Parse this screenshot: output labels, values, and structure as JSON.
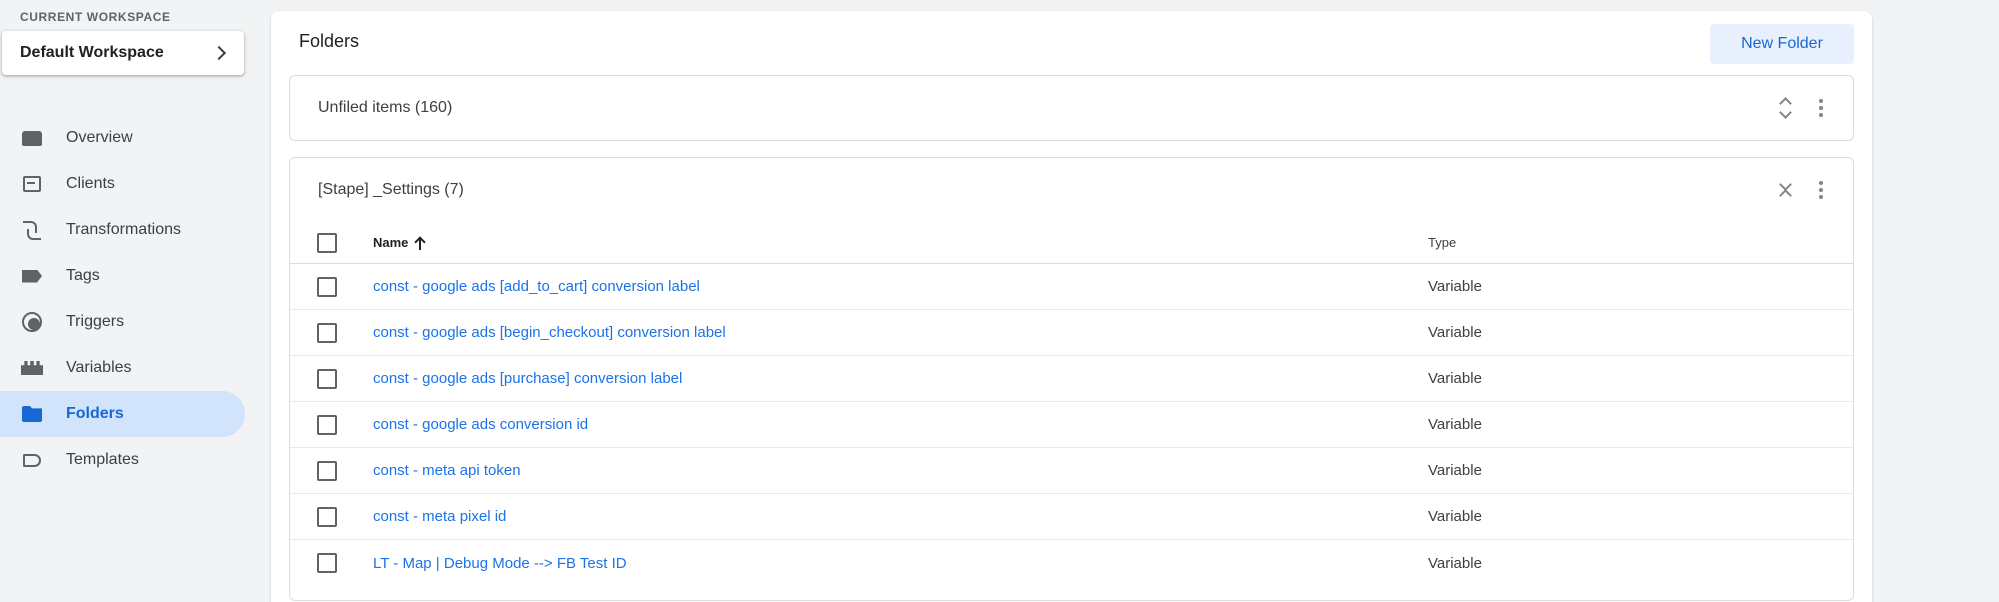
{
  "sidebar": {
    "workspace_caption": "CURRENT WORKSPACE",
    "workspace_name": "Default Workspace",
    "items": [
      {
        "label": "Overview",
        "icon": "overview-icon"
      },
      {
        "label": "Clients",
        "icon": "clients-icon"
      },
      {
        "label": "Transformations",
        "icon": "transformations-icon"
      },
      {
        "label": "Tags",
        "icon": "tag-icon"
      },
      {
        "label": "Triggers",
        "icon": "trigger-icon"
      },
      {
        "label": "Variables",
        "icon": "variables-icon"
      },
      {
        "label": "Folders",
        "icon": "folder-icon",
        "active": true
      },
      {
        "label": "Templates",
        "icon": "template-icon"
      }
    ]
  },
  "main": {
    "title": "Folders",
    "new_folder_label": "New Folder",
    "unfiled": {
      "title": "Unfiled items (160)"
    },
    "folder": {
      "title": "[Stape] _Settings (7)",
      "columns": {
        "name": "Name",
        "type": "Type"
      },
      "rows": [
        {
          "name": "const - google ads [add_to_cart] conversion label",
          "type": "Variable"
        },
        {
          "name": "const - google ads [begin_checkout] conversion label",
          "type": "Variable"
        },
        {
          "name": "const - google ads [purchase] conversion label",
          "type": "Variable"
        },
        {
          "name": "const - google ads conversion id",
          "type": "Variable"
        },
        {
          "name": "const - meta api token",
          "type": "Variable"
        },
        {
          "name": "const - meta pixel id",
          "type": "Variable"
        },
        {
          "name": "LT - Map | Debug Mode --> FB Test ID",
          "type": "Variable"
        }
      ]
    }
  },
  "colors": {
    "accent": "#1967d2",
    "link": "#1a73e8",
    "active_bg": "#d2e3fc",
    "button_bg": "#e8f0fe"
  }
}
